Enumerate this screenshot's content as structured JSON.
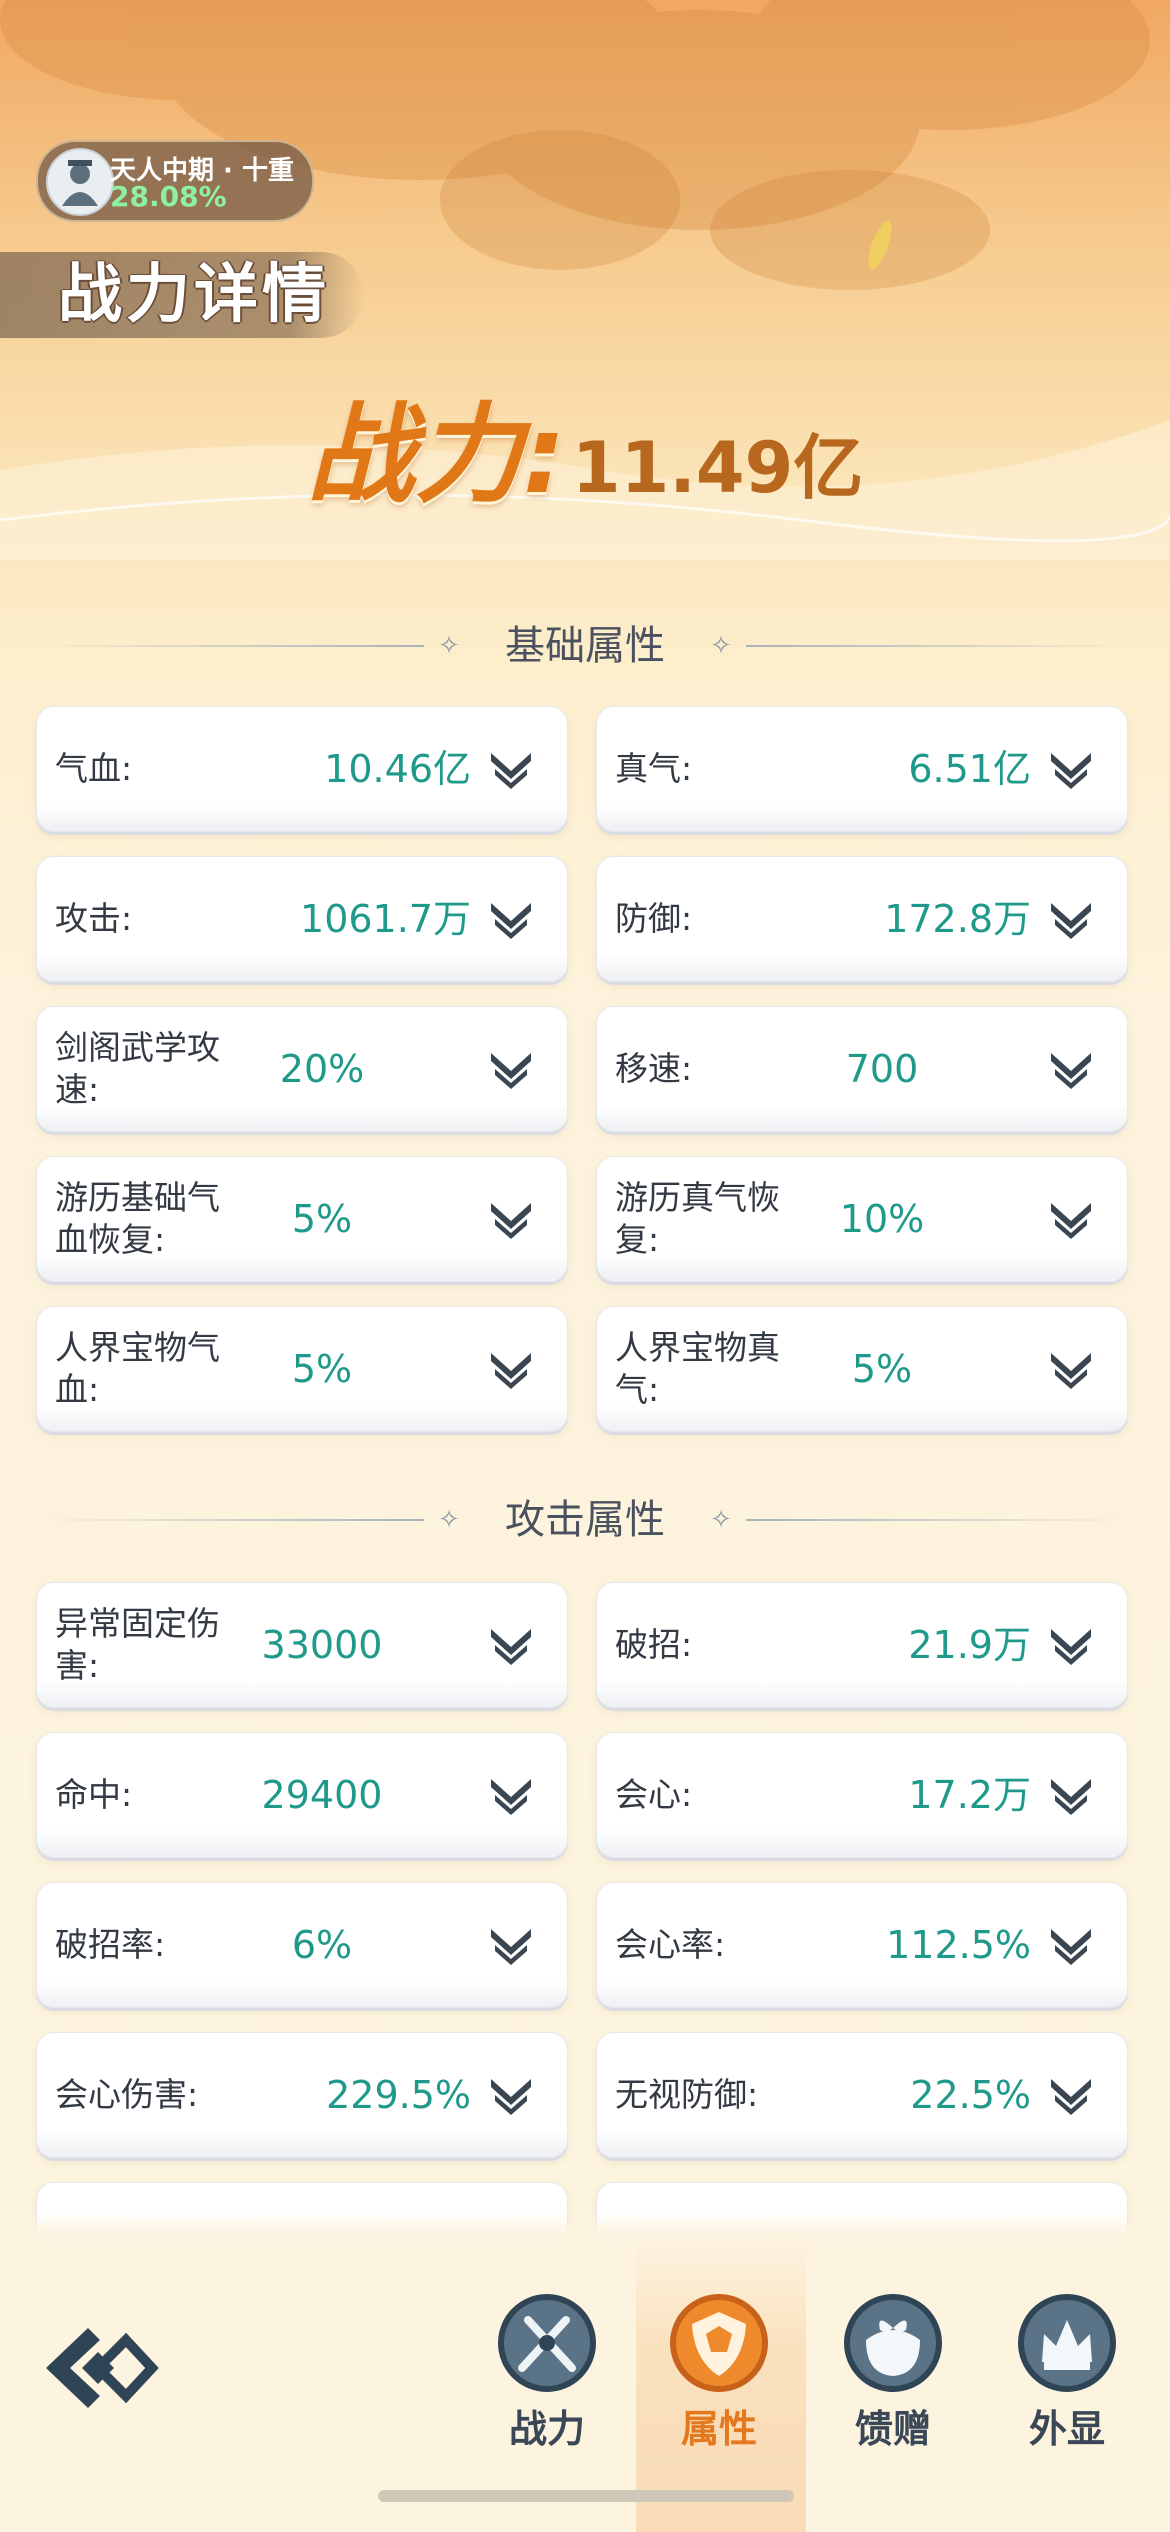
{
  "rank": {
    "title": "天人中期 · 十重",
    "progress": "28.08%"
  },
  "page_title": "战力详情",
  "power": {
    "label": "战力:",
    "value": "11.49亿"
  },
  "sections": {
    "basic": {
      "title": "基础属性",
      "stats": [
        {
          "label": "气血:",
          "value": "10.46亿"
        },
        {
          "label": "真气:",
          "value": "6.51亿"
        },
        {
          "label": "攻击:",
          "value": "1061.7万"
        },
        {
          "label": "防御:",
          "value": "172.8万"
        },
        {
          "label": "剑阁武学攻速:",
          "value": "20%"
        },
        {
          "label": "移速:",
          "value": "700"
        },
        {
          "label": "游历基础气血恢复:",
          "value": "5%"
        },
        {
          "label": "游历真气恢复:",
          "value": "10%"
        },
        {
          "label": "人界宝物气血:",
          "value": "5%"
        },
        {
          "label": "人界宝物真气:",
          "value": "5%"
        }
      ]
    },
    "attack": {
      "title": "攻击属性",
      "stats": [
        {
          "label": "异常固定伤害:",
          "value": "33000"
        },
        {
          "label": "破招:",
          "value": "21.9万"
        },
        {
          "label": "命中:",
          "value": "29400"
        },
        {
          "label": "会心:",
          "value": "17.2万"
        },
        {
          "label": "破招率:",
          "value": "6%"
        },
        {
          "label": "会心率:",
          "value": "112.5%"
        },
        {
          "label": "会心伤害:",
          "value": "229.5%"
        },
        {
          "label": "无视防御:",
          "value": "22.5%"
        }
      ]
    }
  },
  "tabs": [
    {
      "label": "战力",
      "icon": "swords-icon",
      "active": false
    },
    {
      "label": "属性",
      "icon": "shield-icon",
      "active": true
    },
    {
      "label": "馈赠",
      "icon": "gift-icon",
      "active": false
    },
    {
      "label": "外显",
      "icon": "crown-icon",
      "active": false
    }
  ],
  "colors": {
    "stat_value": "#1f9a8a",
    "power_label": "#e07818",
    "active_tab": "#e4781f",
    "tab_icon": "#3f5468"
  }
}
